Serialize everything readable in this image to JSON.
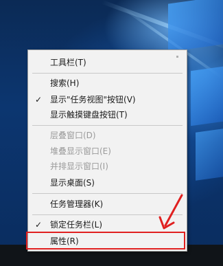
{
  "context_menu": {
    "items": [
      {
        "label": "工具栏(T)",
        "checked": false,
        "disabled": false
      },
      {
        "label": "搜索(H)",
        "checked": false,
        "disabled": false
      },
      {
        "label": "显示\"任务视图\"按钮(V)",
        "checked": true,
        "disabled": false
      },
      {
        "label": "显示触摸键盘按钮(T)",
        "checked": false,
        "disabled": false
      },
      {
        "label": "层叠窗口(D)",
        "checked": false,
        "disabled": true
      },
      {
        "label": "堆叠显示窗口(E)",
        "checked": false,
        "disabled": true
      },
      {
        "label": "并排显示窗口(I)",
        "checked": false,
        "disabled": true
      },
      {
        "label": "显示桌面(S)",
        "checked": false,
        "disabled": false
      },
      {
        "label": "任务管理器(K)",
        "checked": false,
        "disabled": false
      },
      {
        "label": "锁定任务栏(L)",
        "checked": true,
        "disabled": false
      },
      {
        "label": "属性(R)",
        "checked": false,
        "disabled": false
      }
    ],
    "check_glyph": "✓"
  },
  "annotation": {
    "color": "#e02020"
  }
}
